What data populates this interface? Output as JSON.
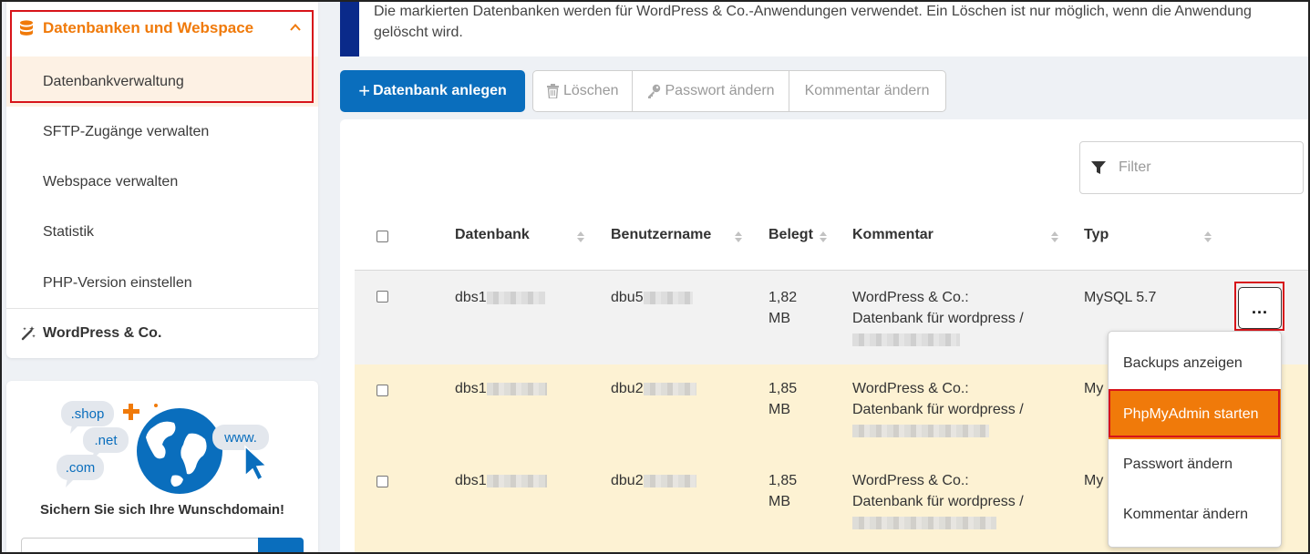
{
  "sidebar": {
    "section_title": "Datenbanken und Webspace",
    "items": [
      {
        "label": "Datenbankverwaltung",
        "active": true
      },
      {
        "label": "SFTP-Zugänge verwalten"
      },
      {
        "label": "Webspace verwalten"
      },
      {
        "label": "Statistik"
      },
      {
        "label": "PHP-Version einstellen"
      }
    ],
    "wordpress_label": "WordPress & Co.",
    "accent_color": "#f07a0a"
  },
  "promo": {
    "tags": [
      ".shop",
      ".net",
      ".com",
      "www."
    ],
    "title": "Sichern Sie sich Ihre Wunschdomain!"
  },
  "notice": {
    "text": "Die markierten Datenbanken werden für WordPress & Co.-Anwendungen verwendet. Ein Löschen ist nur möglich, wenn die Anwendung gelöscht wird."
  },
  "toolbar": {
    "create_label": "Datenbank anlegen",
    "delete_label": "Löschen",
    "password_label": "Passwort ändern",
    "comment_label": "Kommentar ändern",
    "primary_color": "#0a6ebd"
  },
  "filter": {
    "placeholder": "Filter"
  },
  "table": {
    "columns": [
      "Datenbank",
      "Benutzername",
      "Belegt",
      "Kommentar",
      "Typ"
    ],
    "rows": [
      {
        "db": "dbs1",
        "user": "dbu5",
        "size": "1,82",
        "unit": "MB",
        "comment_1": "WordPress & Co.:",
        "comment_2": "Datenbank für wordpress /",
        "type": "MySQL 5.7"
      },
      {
        "db": "dbs1",
        "user": "dbu2",
        "size": "1,85",
        "unit": "MB",
        "comment_1": "WordPress & Co.:",
        "comment_2": "Datenbank für wordpress /",
        "type": "My"
      },
      {
        "db": "dbs1",
        "user": "dbu2",
        "size": "1,85",
        "unit": "MB",
        "comment_1": "WordPress & Co.:",
        "comment_2": "Datenbank für wordpress /",
        "type": "My"
      }
    ]
  },
  "row_menu": {
    "trigger_label": "...",
    "items": [
      {
        "label": "Backups anzeigen"
      },
      {
        "label": "PhpMyAdmin starten",
        "highlighted": true
      },
      {
        "label": "Passwort ändern"
      },
      {
        "label": "Kommentar ändern"
      }
    ]
  }
}
